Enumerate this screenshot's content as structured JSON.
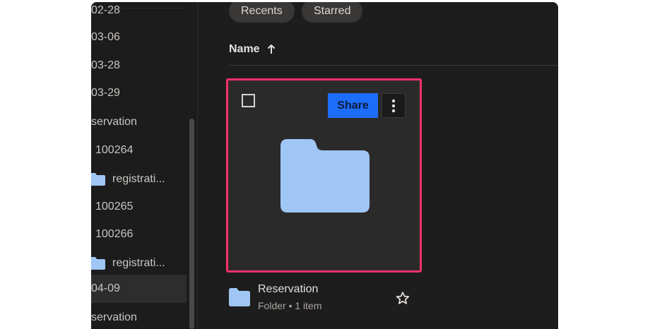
{
  "sidebar": {
    "items": [
      {
        "label": "02-28",
        "type": "text"
      },
      {
        "label": "03-06",
        "type": "text"
      },
      {
        "label": "03-28",
        "type": "text"
      },
      {
        "label": "03-29",
        "type": "text"
      },
      {
        "label": "servation",
        "type": "text"
      },
      {
        "label": "100264",
        "type": "text"
      },
      {
        "label": "registrati...",
        "type": "folder"
      },
      {
        "label": "100265",
        "type": "text"
      },
      {
        "label": "100266",
        "type": "text"
      },
      {
        "label": "registrati...",
        "type": "folder"
      },
      {
        "label": "04-09",
        "type": "text",
        "selected": true
      },
      {
        "label": "servation",
        "type": "text"
      }
    ]
  },
  "filters": {
    "recents_label": "Recents",
    "starred_label": "Starred"
  },
  "list_header": {
    "name_label": "Name",
    "sort_icon": "arrow-up-icon"
  },
  "card": {
    "share_label": "Share",
    "more_icon": "more-vertical-icon",
    "folder_icon": "folder-icon"
  },
  "item": {
    "name": "Reservation",
    "meta": "Folder • 1 item",
    "star_icon": "star-outline-icon"
  },
  "colors": {
    "background": "#1e1d1d",
    "accent": "#1d6dfb",
    "highlight": "#f4316b",
    "folder": "#9fc6f5"
  }
}
